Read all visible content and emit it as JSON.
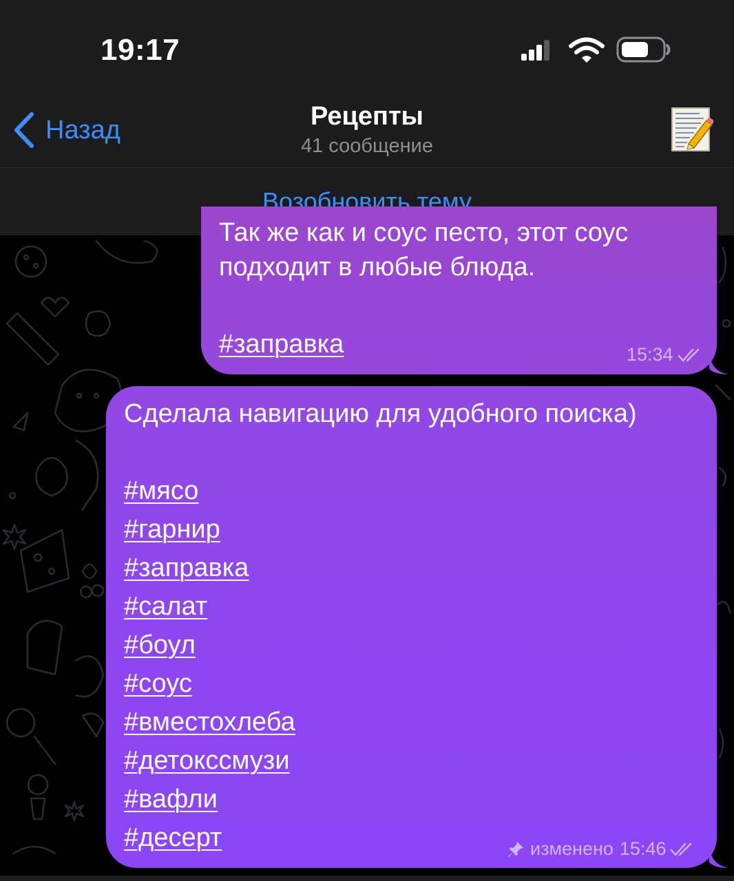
{
  "status_bar": {
    "time": "19:17"
  },
  "header": {
    "back_label": "Назад",
    "title": "Рецепты",
    "subtitle": "41 сообщение"
  },
  "reopen": {
    "label": "Возобновить тему"
  },
  "messages": [
    {
      "clipped_line": "Так же как и соус песто, этот соус",
      "text": "подходит в любые блюда.",
      "hashtag": "#заправка",
      "time": "15:34"
    },
    {
      "text": "Сделала навигацию для удобного поиска)",
      "hashtags": [
        "#мясо",
        "#гарнир",
        "#заправка",
        "#салат",
        "#боул",
        "#соус",
        "#вместохлеба",
        "#детокссмузи",
        "#вафли",
        "#десерт"
      ],
      "edited_label": "изменено",
      "time": "15:46"
    }
  ],
  "colors": {
    "accent": "#3e8ef7",
    "bubble_top": "#9a46cf",
    "bubble_bottom": "#8c46f6",
    "bar_bg": "#1c1c1e"
  },
  "icons": [
    "signal-icon",
    "wifi-icon",
    "battery-icon",
    "back-chevron-icon",
    "topic-notepad-icon",
    "pin-icon",
    "double-check-icon"
  ]
}
